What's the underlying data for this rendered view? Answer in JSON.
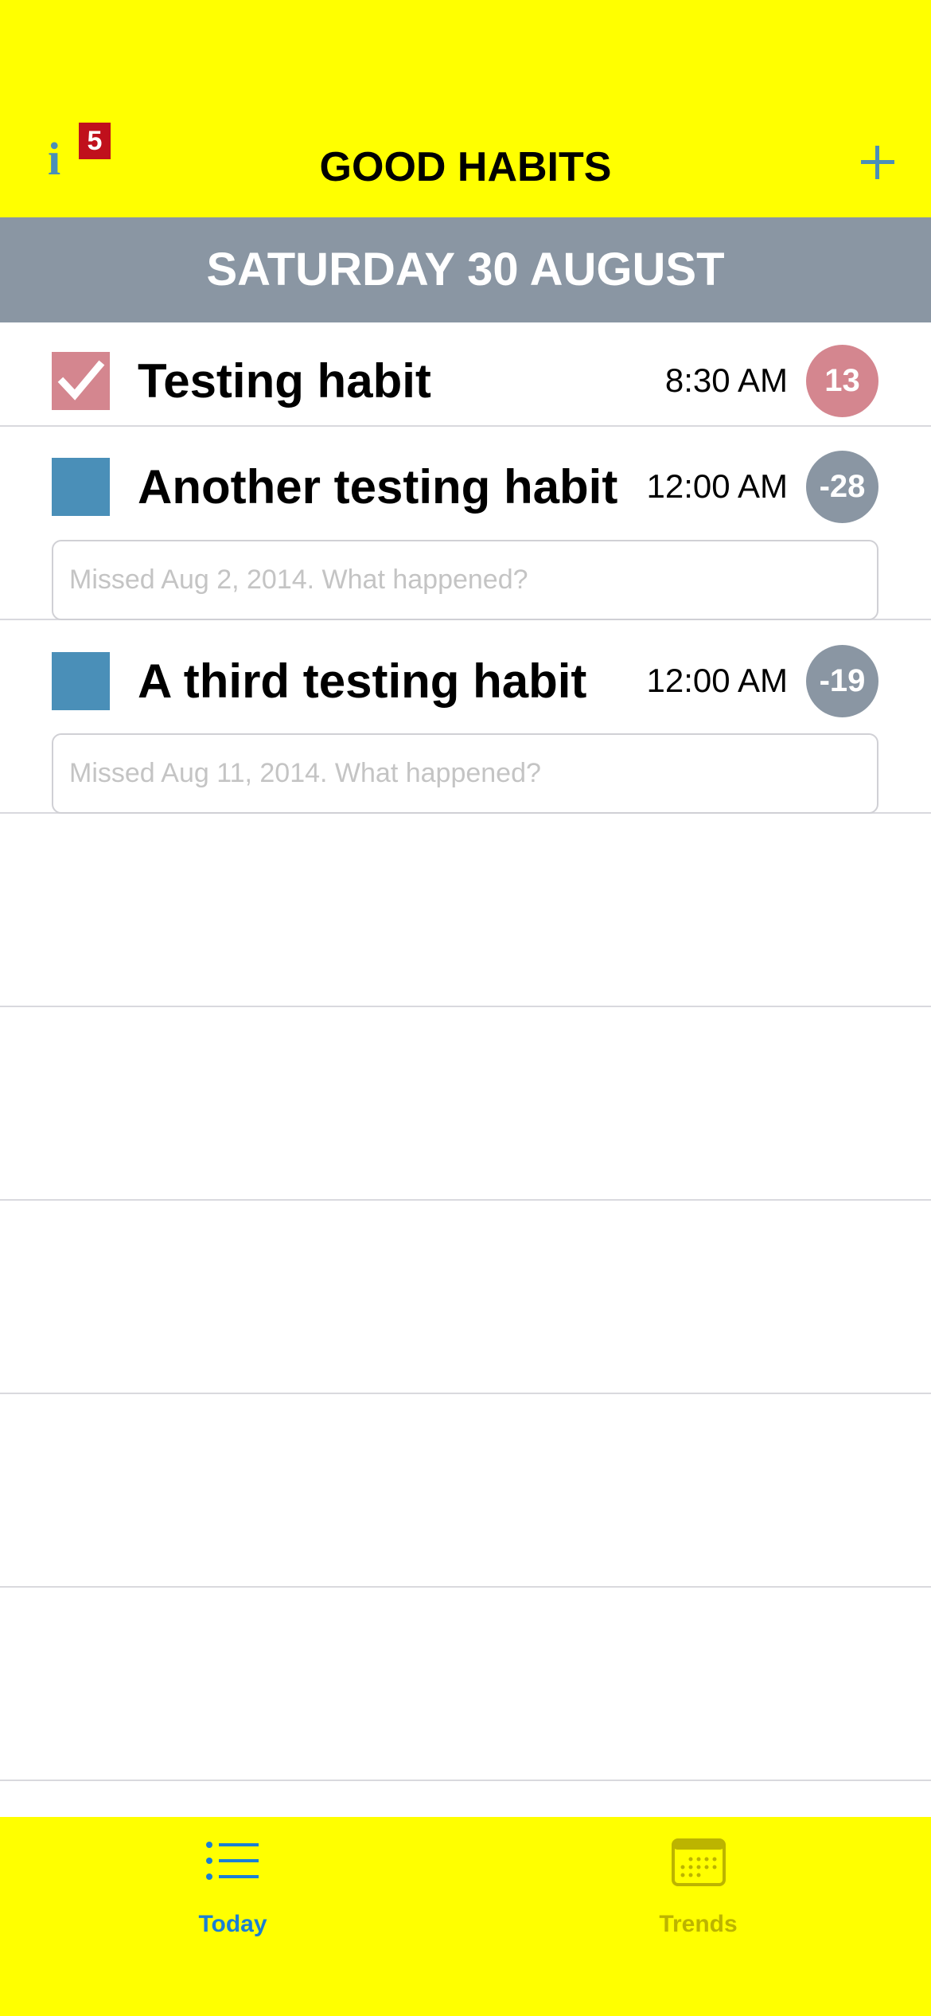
{
  "header": {
    "title": "GOOD HABITS",
    "info_icon": "info-icon",
    "info_glyph": "i",
    "info_badge": "5",
    "add_icon": "plus-icon"
  },
  "date_banner": "SATURDAY 30 AUGUST",
  "habits": [
    {
      "name": "Testing habit",
      "time": "8:30 AM",
      "streak": "13",
      "checked": true,
      "note_placeholder": ""
    },
    {
      "name": "Another testing habit",
      "time": "12:00 AM",
      "streak": "-28",
      "checked": false,
      "note_placeholder": "Missed Aug 2, 2014. What happened?"
    },
    {
      "name": "A third testing habit",
      "time": "12:00 AM",
      "streak": "-19",
      "checked": false,
      "note_placeholder": "Missed Aug 11, 2014. What happened?"
    }
  ],
  "tabs": [
    {
      "label": "Today",
      "icon": "list-icon",
      "active": true
    },
    {
      "label": "Trends",
      "icon": "calendar-icon",
      "active": false
    }
  ],
  "colors": {
    "bar_yellow": "#ffff00",
    "accent_blue": "#4a8fb8",
    "checked_pink": "#d4868f",
    "banner_gray": "#8a96a3",
    "badge_red": "#c0101c",
    "tab_active": "#1a7fd4",
    "tab_inactive": "#bcb400"
  }
}
